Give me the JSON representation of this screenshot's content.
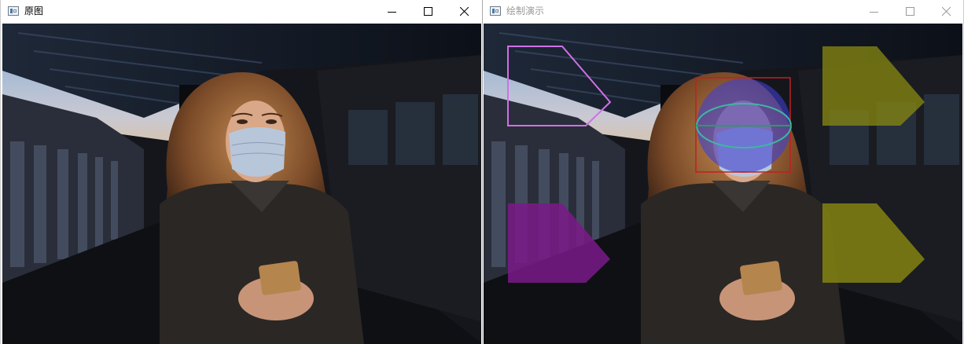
{
  "windows": {
    "left": {
      "title": "原图",
      "icon": "app-window-icon"
    },
    "right": {
      "title": "绘制演示",
      "icon": "app-window-icon"
    }
  },
  "caption_buttons": [
    "minimize-icon",
    "maximize-icon",
    "close-icon"
  ],
  "colors": {
    "titlebar_bg": "#ffffff",
    "polygon_outline": "#d070e8",
    "filled_polygon_purple": "#7a1a8a",
    "filled_polygon_yellow": "#8a8a10",
    "face_circle": "#4040d0",
    "face_rect": "#c02020",
    "face_ellipse": "#3cb8a0",
    "face_line": "#20a060"
  }
}
